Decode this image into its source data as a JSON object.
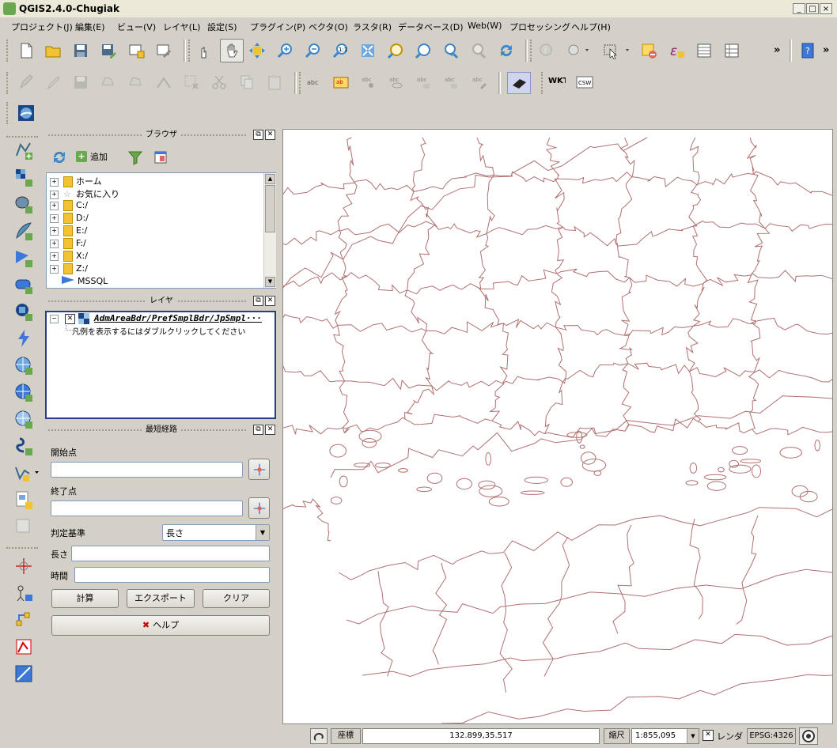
{
  "window": {
    "title": "QGIS2.4.0-Chugiak",
    "minimize": "_",
    "maximize": "□",
    "close": "×"
  },
  "menu": [
    "プロジェクト(J)",
    "編集(E)",
    "ビュー(V)",
    "レイヤ(L)",
    "設定(S)",
    "プラグイン(P)",
    "ベクタ(O)",
    "ラスタ(R)",
    "データベース(D)",
    "Web(W)",
    "プロセッシング",
    "ヘルプ(H)"
  ],
  "toolbar": {
    "overflow": "»",
    "wkt_label": "WKT",
    "csw_label": "CSW",
    "abc": "abc"
  },
  "browser": {
    "title": "ブラウザ",
    "add_label": "追加",
    "items": [
      "ホーム",
      "お気に入り",
      "C:/",
      "D:/",
      "E:/",
      "F:/",
      "X:/",
      "Z:/",
      "MSSQL"
    ]
  },
  "layers": {
    "title": "レイヤ",
    "layer_name": "AdmAreaBdr/PrefSmplBdr/JpSmpl···",
    "legend_hint": "凡例を表示するにはダブルクリックしてください"
  },
  "route": {
    "title": "最短経路",
    "start_label": "開始点",
    "end_label": "終了点",
    "criterion_label": "判定基準",
    "criterion_value": "長さ",
    "length_label": "長さ",
    "time_label": "時間",
    "calc_button": "計算",
    "export_button": "エクスポート",
    "clear_button": "クリア",
    "help_button": "ヘルプ"
  },
  "status": {
    "coord_label": "座標",
    "coord_value": "132.899,35.517",
    "scale_label": "縮尺",
    "scale_value": "1:855,095",
    "render_label": "レンダ",
    "crs": "EPSG:4326"
  },
  "colors": {
    "boundary": "#b07070",
    "map_bg": "#ffffff",
    "chrome": "#d4d0c8"
  }
}
